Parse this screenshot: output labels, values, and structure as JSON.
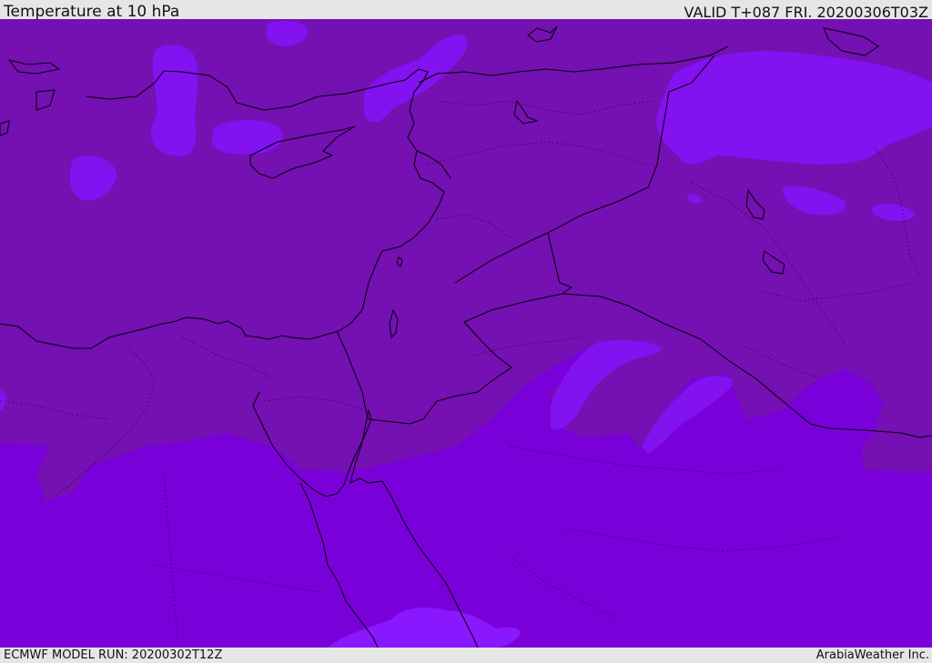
{
  "header": {
    "title": "Temperature at 10 hPa",
    "valid": "VALID T+087 FRI. 20200306T03Z"
  },
  "footer": {
    "model_run": "ECMWF MODEL RUN: 20200302T12Z",
    "brand": "ArabiaWeather Inc."
  },
  "map": {
    "colors": {
      "warm_band": "#7510b3",
      "cool_band": "#7a00d9",
      "cold_patch": "#8212f0",
      "coldest_patch": "#8a18ff",
      "coastline": "#000000",
      "border": "#000000"
    }
  }
}
